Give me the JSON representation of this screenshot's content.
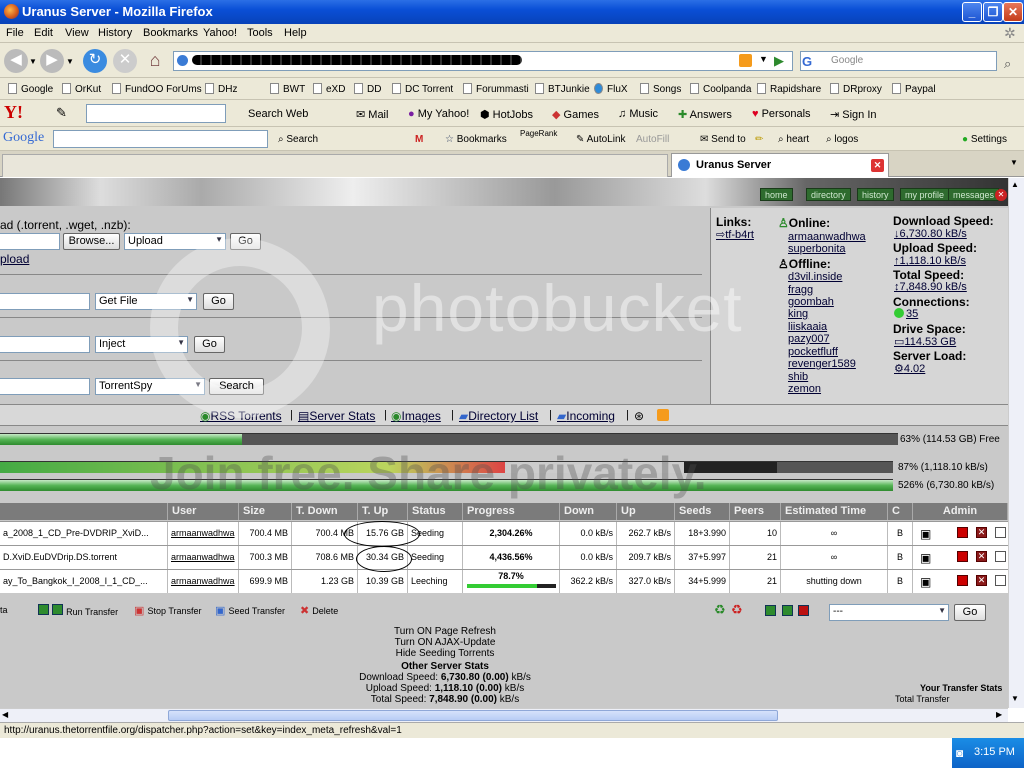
{
  "window": {
    "title": "Uranus Server - Mozilla Firefox"
  },
  "menu": [
    "File",
    "Edit",
    "View",
    "History",
    "Bookmarks",
    "Yahoo!",
    "Tools",
    "Help"
  ],
  "search": {
    "placeholder": "Google"
  },
  "bookmarks": [
    "Google",
    "OrKut",
    "FundOO ForUms",
    "DHz",
    "BWT",
    "eXD",
    "DD",
    "DC Torrent",
    "Forummasti",
    "BTJunkie",
    "FluX",
    "Songs",
    "Coolpanda",
    "Rapidshare",
    "DRproxy",
    "Paypal"
  ],
  "yahoo_toolbar": {
    "search": "Search Web",
    "items": [
      "Mail",
      "My Yahoo!",
      "HotJobs",
      "Games",
      "Music",
      "Answers",
      "Personals",
      "Sign In"
    ]
  },
  "google_toolbar": {
    "logo": "Google",
    "search": "Search",
    "items": [
      "Bookmarks",
      "AutoLink",
      "AutoFill",
      "Send to",
      "heart",
      "logos",
      "Settings"
    ],
    "pagerank": "PageRank"
  },
  "tab": {
    "title": "Uranus Server"
  },
  "nav_links": [
    "home",
    "directory",
    "history",
    "my profile",
    "messages"
  ],
  "upload": {
    "label": "ad (.torrent, .wget, .nzb):",
    "browse": "Browse...",
    "select": "Upload",
    "go": "Go",
    "link": "pload"
  },
  "getfile": {
    "select": "Get File",
    "go": "Go"
  },
  "inject": {
    "select": "Inject",
    "go": "Go"
  },
  "torrentspy": {
    "select": "TorrentSpy",
    "button": "Search"
  },
  "links": {
    "title": "Links:",
    "item": "tf-b4rt"
  },
  "online": {
    "title": "Online:",
    "users": [
      "armaanwadhwa",
      "superbonita"
    ]
  },
  "offline": {
    "title": "Offline:",
    "users": [
      "d3vil.inside",
      "fragg",
      "goombah",
      "king",
      "liiskaaia",
      "pazy007",
      "pocketfluff",
      "revenger1589",
      "shib",
      "zemon"
    ]
  },
  "stats": [
    {
      "label": "Download Speed:",
      "value": "6,730.80 kB/s"
    },
    {
      "label": "Upload Speed:",
      "value": "1,118.10 kB/s"
    },
    {
      "label": "Total Speed:",
      "value": "7,848.90 kB/s"
    },
    {
      "label": "Connections:",
      "value": "35"
    },
    {
      "label": "Drive Space:",
      "value": "114.53 GB"
    },
    {
      "label": "Server Load:",
      "value": "4.02"
    }
  ],
  "quicklinks": [
    "RSS Torrents",
    "Server Stats",
    "Images",
    "Directory List",
    "Incoming"
  ],
  "bars": [
    {
      "fraction": 0.27,
      "label": "63% (114.53 GB) Free"
    },
    {
      "fraction": 0.87,
      "label": "87% (1,118.10 kB/s)"
    },
    {
      "fraction": 1.0,
      "label": "526% (6,730.80 kB/s)"
    }
  ],
  "table": {
    "headers": [
      "User",
      "Size",
      "T. Down",
      "T. Up",
      "Status",
      "Progress",
      "Down",
      "Up",
      "Seeds",
      "Peers",
      "Estimated Time",
      "C",
      "Admin"
    ],
    "rows": [
      {
        "name": "a_2008_1_CD_Pre-DVDRIP_XviD...",
        "user": "armaanwadhwa",
        "size": "700.4 MB",
        "tdown": "700.4 MB",
        "tup": "15.76 GB",
        "status": "Seeding",
        "progress": "2,304.26%",
        "down": "0.0 kB/s",
        "up": "262.7 kB/s",
        "seeds": "18+3.990",
        "peers": "10",
        "eta": "∞",
        "c": "B"
      },
      {
        "name": "D.XviD.EuDVDrip.DS.torrent",
        "user": "armaanwadhwa",
        "size": "700.3 MB",
        "tdown": "708.6 MB",
        "tup": "30.34 GB",
        "status": "Seeding",
        "progress": "4,436.56%",
        "down": "0.0 kB/s",
        "up": "209.7 kB/s",
        "seeds": "37+5.997",
        "peers": "21",
        "eta": "∞",
        "c": "B"
      },
      {
        "name": "ay_To_Bangkok_I_2008_I_1_CD_...",
        "user": "armaanwadhwa",
        "size": "699.9 MB",
        "tdown": "1.23 GB",
        "tup": "10.39 GB",
        "status": "Leeching",
        "progress": "78.7%",
        "progress_fraction": 0.787,
        "down": "362.2 kB/s",
        "up": "327.0 kB/s",
        "seeds": "34+5.999",
        "peers": "21",
        "eta": "shutting down",
        "c": "B"
      }
    ]
  },
  "actions": {
    "left": "ta",
    "run": "Run Transfer",
    "stop": "Stop Transfer",
    "seed": "Seed Transfer",
    "delete": "Delete",
    "select": "---",
    "go": "Go"
  },
  "footer": {
    "lines": [
      "Turn ON Page Refresh",
      "Turn ON AJAX-Update",
      "Hide Seeding Torrents"
    ],
    "other_title": "Other Server Stats",
    "other": [
      {
        "label": "Download Speed:",
        "value": "6,730.80 (0.00)",
        "unit": "kB/s"
      },
      {
        "label": "Upload Speed:",
        "value": "1,118.10 (0.00)",
        "unit": "kB/s"
      },
      {
        "label": "Total Speed:",
        "value": "7,848.90 (0.00)",
        "unit": "kB/s"
      }
    ],
    "your_stats": "Your Transfer Stats",
    "your_total": "Total Transfer"
  },
  "watermark": {
    "logo": "photobucket",
    "slogan": "Join free. Share privately."
  },
  "status": "http://uranus.thetorrentfile.org/dispatcher.php?action=set&key=index_meta_refresh&val=1",
  "clock": "3:15 PM",
  "colors": {
    "titlebar": "#0a4fd6",
    "progress_green": "#55b455",
    "header_gray": "#7b7b7b",
    "content_bg": "#c9c9c9"
  }
}
